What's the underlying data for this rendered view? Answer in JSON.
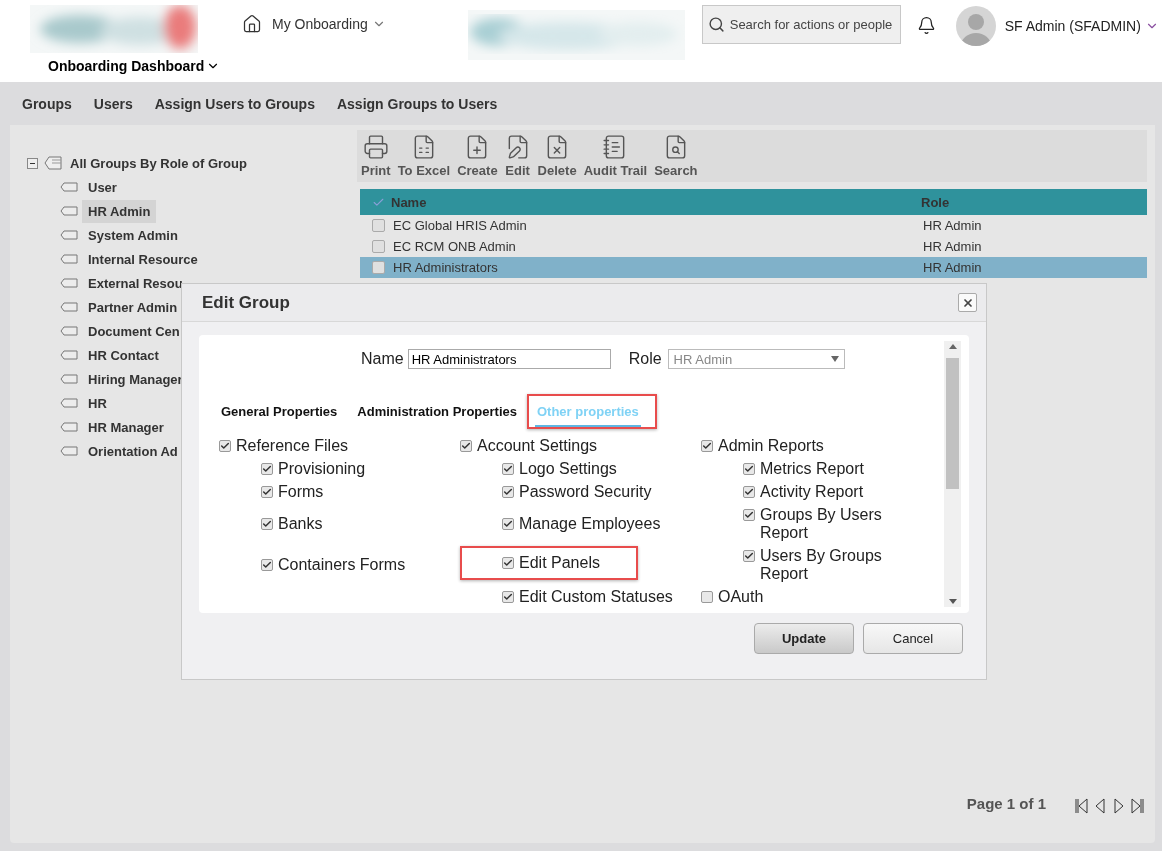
{
  "header": {
    "module": "My Onboarding",
    "page": "Onboarding Dashboard",
    "search": {
      "placeholder": "Search for actions or people"
    },
    "user": "SF Admin (SFADMIN)"
  },
  "nav": [
    "Groups",
    "Users",
    "Assign Users to Groups",
    "Assign Groups to Users"
  ],
  "tree": {
    "label": "All Groups By Role of Group",
    "expanded": true,
    "children": [
      {
        "label": "User",
        "selected": false
      },
      {
        "label": "HR Admin",
        "selected": true
      },
      {
        "label": "System Admin",
        "selected": false
      },
      {
        "label": "Internal Resource",
        "selected": false
      },
      {
        "label": "External Resou",
        "selected": false
      },
      {
        "label": "Partner Admin",
        "selected": false
      },
      {
        "label": "Document Cen",
        "selected": false
      },
      {
        "label": "HR Contact",
        "selected": false
      },
      {
        "label": "Hiring Manager",
        "selected": false
      },
      {
        "label": "HR",
        "selected": false
      },
      {
        "label": "HR Manager",
        "selected": false
      },
      {
        "label": "Orientation Ad",
        "selected": false
      }
    ]
  },
  "toolbar": [
    {
      "label": "Print",
      "kind": "print"
    },
    {
      "label": "To Excel",
      "kind": "excel"
    },
    {
      "label": "Create",
      "kind": "create"
    },
    {
      "label": "Edit",
      "kind": "edit"
    },
    {
      "label": "Delete",
      "kind": "delete"
    },
    {
      "label": "Audit Trail",
      "kind": "audit"
    },
    {
      "label": "Search",
      "kind": "search"
    }
  ],
  "table": {
    "columns": [
      "Name",
      "Role"
    ],
    "rows": [
      {
        "name": "EC Global HRIS Admin",
        "role": "HR Admin",
        "checked": false,
        "selected": false
      },
      {
        "name": "EC RCM ONB Admin",
        "role": "HR Admin",
        "checked": false,
        "selected": false
      },
      {
        "name": "HR Administrators",
        "role": "HR Admin",
        "checked": false,
        "selected": true
      }
    ]
  },
  "dialog": {
    "title": "Edit Group",
    "name_label": "Name",
    "name_value": "HR Administrators",
    "role_label": "Role",
    "role_value": "HR Admin",
    "tabs": [
      {
        "label": "General Properties",
        "selected": false,
        "highlighted": false
      },
      {
        "label": "Administration Properties",
        "selected": false,
        "highlighted": false
      },
      {
        "label": "Other properties",
        "selected": true,
        "highlighted": true
      }
    ],
    "columns": [
      [
        {
          "label": "Reference Files",
          "checked": true,
          "highlighted": false,
          "children": [
            {
              "label": "Provisioning",
              "checked": true,
              "highlighted": false
            },
            {
              "label": "Forms",
              "checked": true,
              "highlighted": false
            },
            {
              "label": "Banks",
              "checked": true,
              "highlighted": false
            },
            {
              "label": "Containers Forms",
              "checked": true,
              "highlighted": false
            }
          ]
        }
      ],
      [
        {
          "label": "Account Settings",
          "checked": true,
          "highlighted": false,
          "children": [
            {
              "label": "Logo Settings",
              "checked": true,
              "highlighted": false
            },
            {
              "label": "Password Security",
              "checked": true,
              "highlighted": false
            },
            {
              "label": "Manage Employees",
              "checked": true,
              "highlighted": false
            },
            {
              "label": "Edit Panels",
              "checked": true,
              "highlighted": true
            },
            {
              "label": "Edit Custom Statuses",
              "checked": true,
              "highlighted": false
            }
          ]
        }
      ],
      [
        {
          "label": "Admin Reports",
          "checked": true,
          "highlighted": false,
          "children": [
            {
              "label": "Metrics Report",
              "checked": true,
              "highlighted": false
            },
            {
              "label": "Activity Report",
              "checked": true,
              "highlighted": false
            },
            {
              "label": "Groups By Users Report",
              "checked": true,
              "highlighted": false
            },
            {
              "label": "Users By Groups Report",
              "checked": true,
              "highlighted": false
            }
          ]
        },
        {
          "label": "OAuth",
          "checked": false,
          "highlighted": false
        }
      ]
    ],
    "buttons": [
      {
        "label": "Update",
        "kind": "primary"
      },
      {
        "label": "Cancel",
        "kind": "secondary"
      }
    ]
  },
  "pagination": {
    "label": "Page 1 of 1"
  }
}
